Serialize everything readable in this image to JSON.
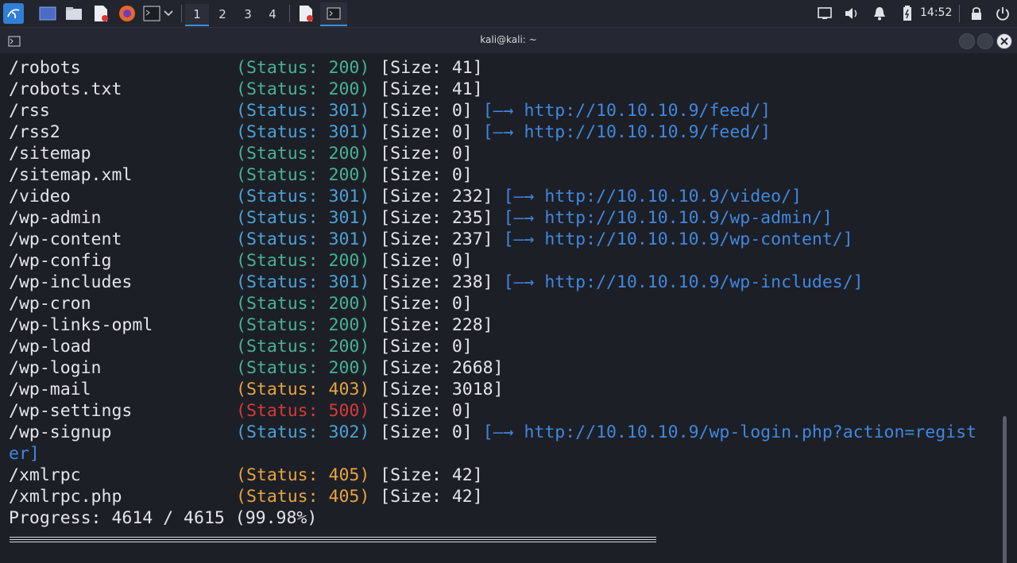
{
  "taskbar": {
    "workspaces": [
      "1",
      "2",
      "3",
      "4"
    ],
    "active_workspace": "1",
    "clock": "14:52",
    "icons": [
      "kali-menu-icon",
      "desktop-icon",
      "file-manager-icon",
      "text-editor-icon",
      "firefox-icon",
      "terminal-icon",
      "chevron-down-icon",
      "pdf-icon",
      "terminal-task-icon",
      "network-icon",
      "volume-icon",
      "bell-icon",
      "battery-icon",
      "lock-icon",
      "power-icon"
    ]
  },
  "window": {
    "title": "kali@kali: ~"
  },
  "terminal": {
    "rows": [
      {
        "path": "/robots",
        "status": "(Status: 200)",
        "code": "200",
        "size": "[Size: 41]",
        "redirect": ""
      },
      {
        "path": "/robots.txt",
        "status": "(Status: 200)",
        "code": "200",
        "size": "[Size: 41]",
        "redirect": ""
      },
      {
        "path": "/rss",
        "status": "(Status: 301)",
        "code": "301",
        "size": "[Size: 0]",
        "redirect": "[—→ http://10.10.10.9/feed/]"
      },
      {
        "path": "/rss2",
        "status": "(Status: 301)",
        "code": "301",
        "size": "[Size: 0]",
        "redirect": "[—→ http://10.10.10.9/feed/]"
      },
      {
        "path": "/sitemap",
        "status": "(Status: 200)",
        "code": "200",
        "size": "[Size: 0]",
        "redirect": ""
      },
      {
        "path": "/sitemap.xml",
        "status": "(Status: 200)",
        "code": "200",
        "size": "[Size: 0]",
        "redirect": ""
      },
      {
        "path": "/video",
        "status": "(Status: 301)",
        "code": "301",
        "size": "[Size: 232]",
        "redirect": "[—→ http://10.10.10.9/video/]"
      },
      {
        "path": "/wp-admin",
        "status": "(Status: 301)",
        "code": "301",
        "size": "[Size: 235]",
        "redirect": "[—→ http://10.10.10.9/wp-admin/]"
      },
      {
        "path": "/wp-content",
        "status": "(Status: 301)",
        "code": "301",
        "size": "[Size: 237]",
        "redirect": "[—→ http://10.10.10.9/wp-content/]"
      },
      {
        "path": "/wp-config",
        "status": "(Status: 200)",
        "code": "200",
        "size": "[Size: 0]",
        "redirect": ""
      },
      {
        "path": "/wp-includes",
        "status": "(Status: 301)",
        "code": "301",
        "size": "[Size: 238]",
        "redirect": "[—→ http://10.10.10.9/wp-includes/]"
      },
      {
        "path": "/wp-cron",
        "status": "(Status: 200)",
        "code": "200",
        "size": "[Size: 0]",
        "redirect": ""
      },
      {
        "path": "/wp-links-opml",
        "status": "(Status: 200)",
        "code": "200",
        "size": "[Size: 228]",
        "redirect": ""
      },
      {
        "path": "/wp-load",
        "status": "(Status: 200)",
        "code": "200",
        "size": "[Size: 0]",
        "redirect": ""
      },
      {
        "path": "/wp-login",
        "status": "(Status: 200)",
        "code": "200",
        "size": "[Size: 2668]",
        "redirect": ""
      },
      {
        "path": "/wp-mail",
        "status": "(Status: 403)",
        "code": "403",
        "size": "[Size: 3018]",
        "redirect": ""
      },
      {
        "path": "/wp-settings",
        "status": "(Status: 500)",
        "code": "500",
        "size": "[Size: 0]",
        "redirect": ""
      },
      {
        "path": "/wp-signup",
        "status": "(Status: 302)",
        "code": "302",
        "size": "[Size: 0]",
        "redirect": "[—→ http://10.10.10.9/wp-login.php?action=regist",
        "redirect_cont": "er]"
      },
      {
        "path": "/xmlrpc",
        "status": "(Status: 405)",
        "code": "405",
        "size": "[Size: 42]",
        "redirect": ""
      },
      {
        "path": "/xmlrpc.php",
        "status": "(Status: 405)",
        "code": "405",
        "size": "[Size: 42]",
        "redirect": ""
      }
    ],
    "progress": "Progress: 4614 / 4615 (99.98%)",
    "status_colors": {
      "200": "#46b396",
      "301": "#4aa3d8",
      "302": "#4aa3d8",
      "403": "#e6a53e",
      "405": "#e6a53e",
      "500": "#d63a3a"
    }
  }
}
